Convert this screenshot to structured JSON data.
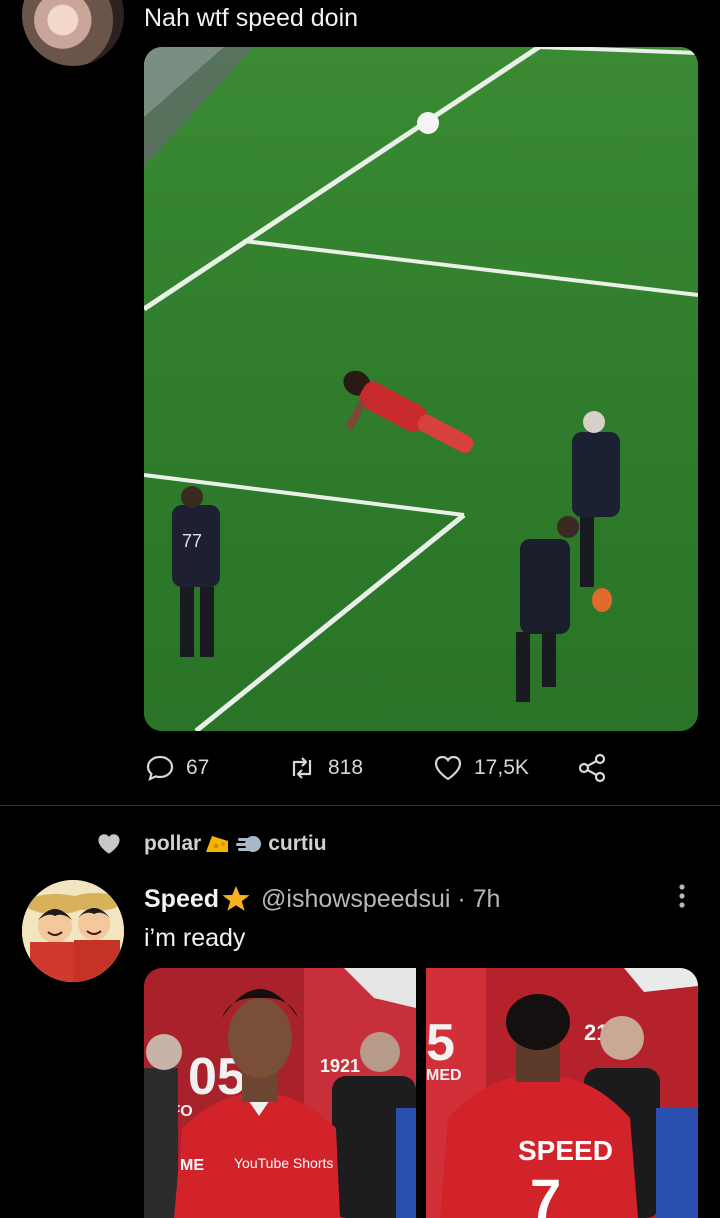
{
  "tweet1": {
    "text": "Nah wtf speed doin",
    "avatar_icon": "avatar-photo",
    "stats": {
      "replies": "67",
      "retweets": "818",
      "likes": "17,5K"
    }
  },
  "tweet2": {
    "liked_by": {
      "first": "pollar",
      "second": "curtiu"
    },
    "display_name": "Speed",
    "handle_time": "@ishowspeedsui · 7h",
    "text": "i’m ready",
    "media_left_text": {
      "banner": "05",
      "year": "1921",
      "sponsor": "YouTube Shorts",
      "side": "ME",
      "side2": "IB FO"
    },
    "media_right_text": {
      "banner": "5",
      "year": "21",
      "banner2": "MED",
      "shirt_name": "SPEED",
      "shirt_number": "7"
    }
  },
  "colors": {
    "background": "#000000",
    "pitch": "#2f7a2c",
    "text": "#e7e9ea",
    "muted": "#b8b8b8",
    "red_kit": "#d2232a"
  }
}
